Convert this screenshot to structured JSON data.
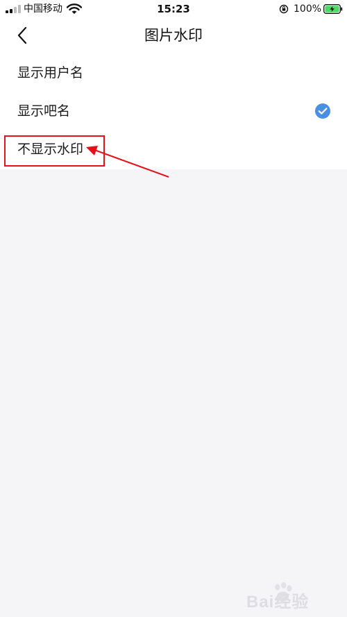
{
  "status_bar": {
    "carrier": "中国移动",
    "time": "15:23",
    "battery_percent": "100%",
    "icons": [
      "signal-icon",
      "wifi-icon",
      "rotation-lock-icon",
      "battery-charging-icon"
    ]
  },
  "nav": {
    "title": "图片水印",
    "back_icon": "chevron-left-icon"
  },
  "options": [
    {
      "label": "显示用户名",
      "selected": false
    },
    {
      "label": "显示吧名",
      "selected": true
    },
    {
      "label": "不显示水印",
      "selected": false
    }
  ],
  "colors": {
    "check_blue": "#4a90e2",
    "annotation_red": "#e4111a",
    "page_background": "#f5f5f8",
    "panel_background": "#ffffff",
    "battery_green": "#4cd964"
  },
  "watermark": {
    "text": "Bai经验"
  }
}
